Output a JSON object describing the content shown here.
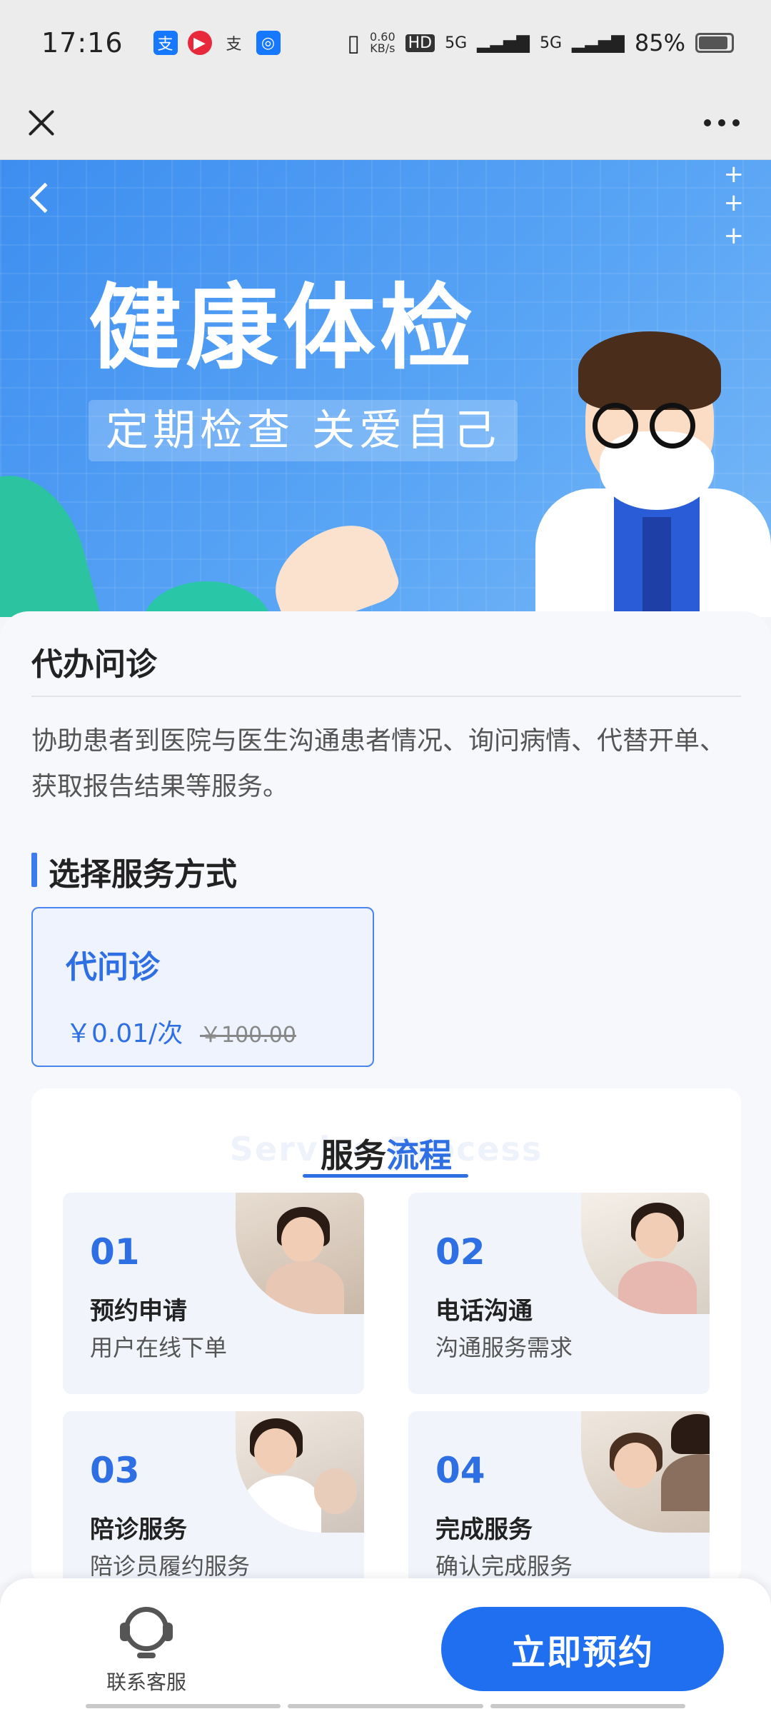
{
  "status_bar": {
    "time": "17:16",
    "net_speed_value": "0.60",
    "net_speed_unit": "KB/s",
    "hd": "HD",
    "sig1": "5G",
    "sig2": "5G",
    "battery": "85%",
    "apps": [
      "alipay-icon",
      "video-icon",
      "alipay-icon",
      "shield-icon"
    ]
  },
  "nav": {
    "close_icon": "close-icon",
    "more_icon": "more-icon"
  },
  "banner": {
    "title": "健康体检",
    "subtitle": "定期检查 关爱自己",
    "plus_signs": [
      "+",
      "+",
      "+"
    ]
  },
  "service": {
    "title": "代办问诊",
    "description": "协助患者到医院与医生沟通患者情况、询问病情、代替开单、获取报告结果等服务。",
    "section_title": "选择服务方式",
    "option": {
      "name": "代问诊",
      "price": "￥0.01/次",
      "original_price": "￥100.00"
    }
  },
  "flow": {
    "watermark": "Service Process",
    "heading_part1": "服务",
    "heading_part2": "流程",
    "steps": [
      {
        "num": "01",
        "name": "预约申请",
        "desc": "用户在线下单"
      },
      {
        "num": "02",
        "name": "电话沟通",
        "desc": "沟通服务需求"
      },
      {
        "num": "03",
        "name": "陪诊服务",
        "desc": "陪诊员履约服务"
      },
      {
        "num": "04",
        "name": "完成服务",
        "desc": "确认完成服务"
      }
    ]
  },
  "bottom": {
    "customer_service": "联系客服",
    "book_button": "立即预约"
  }
}
